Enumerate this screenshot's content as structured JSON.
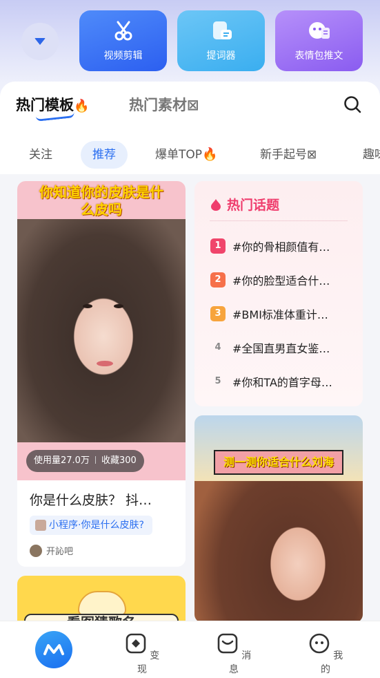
{
  "tools": {
    "video_edit": "视频剪辑",
    "prompter": "提词器",
    "meme_post": "表情包推文"
  },
  "main_tabs": {
    "hot_templates": "热门模板",
    "hot_materials": "热门素材"
  },
  "subtabs": [
    "关注",
    "推荐",
    "爆单TOP",
    "新手起号",
    "趣味"
  ],
  "subtab_active": "推荐",
  "left_card": {
    "image_title": "你知道你的皮肤是什么皮吗",
    "usage": "使用量27.0万",
    "favorites": "收藏300",
    "title": "你是什么皮肤？ 抖…",
    "mini_program": "小程序·你是什么皮肤?",
    "author": "开訫吧"
  },
  "hot_topics": {
    "title": "热门话题",
    "items": [
      {
        "rank": "1",
        "text": "#你的骨相颜值有…",
        "color": "#f0456b"
      },
      {
        "rank": "2",
        "text": "#你的脸型适合什…",
        "color": "#f6704a"
      },
      {
        "rank": "3",
        "text": "#BMI标准体重计…",
        "color": "#f7a43d"
      },
      {
        "rank": "4",
        "text": "#全国直男直女鉴…",
        "color": ""
      },
      {
        "rank": "5",
        "text": "#你和TA的首字母…",
        "color": ""
      }
    ]
  },
  "right_card2": {
    "banner": "测一测你适合什么刘海"
  },
  "left_card2": {
    "banner": "看图猜歌名"
  },
  "bottom_nav": {
    "monetize": "变现",
    "messages": "消息",
    "mine": "我的"
  },
  "colors": {
    "accent": "#2b6ff0",
    "hot_red": "#ef3d6d"
  }
}
